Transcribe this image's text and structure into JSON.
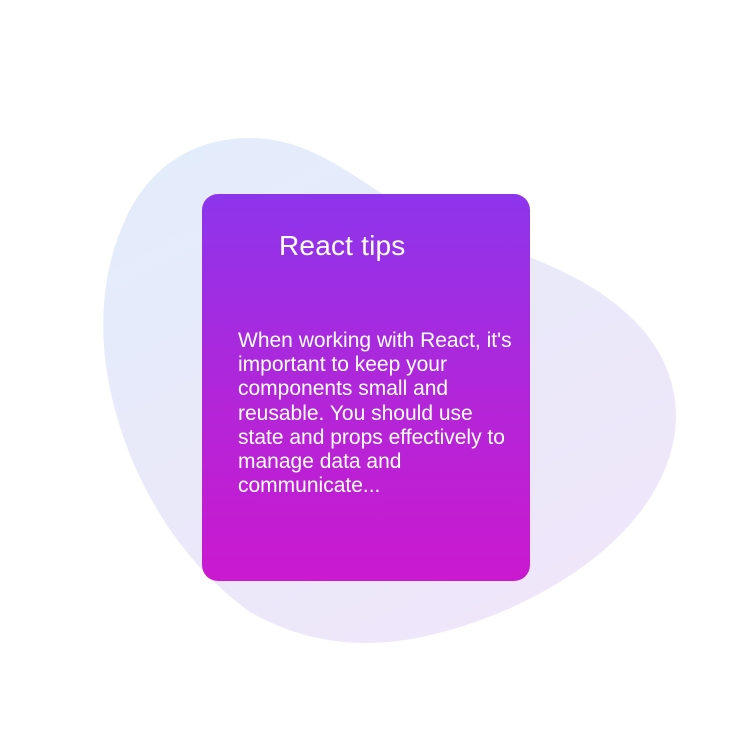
{
  "card": {
    "title": "React tips",
    "body": "When working with React, it's important to keep your components small and reusable. You should use state and props effectively to manage data and communicate..."
  },
  "colors": {
    "background": "#ffffff",
    "blob_top": "#e2edfb",
    "blob_bottom": "#eee7fa",
    "card_top": "#8d35ec",
    "card_bottom": "#ca19cf",
    "text": "#ffffff"
  }
}
